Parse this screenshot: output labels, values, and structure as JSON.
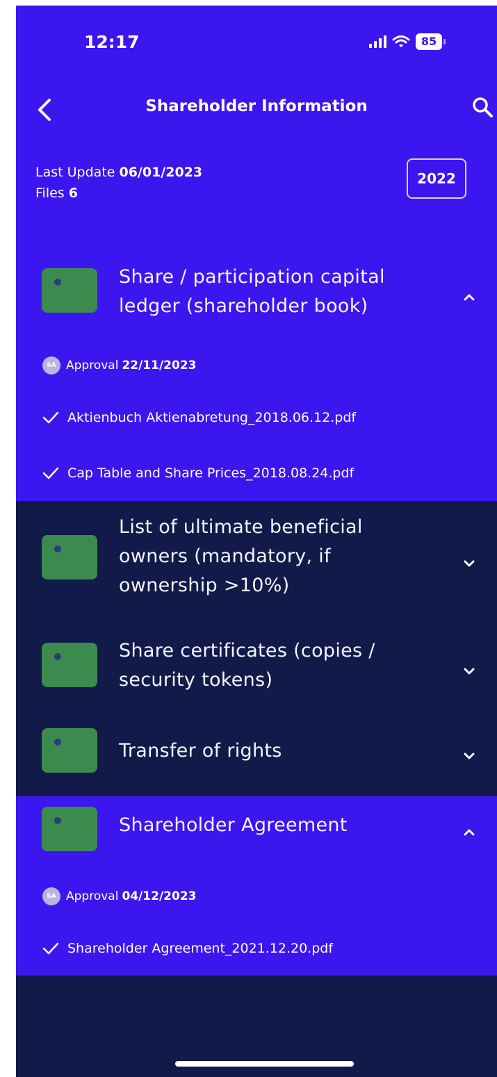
{
  "status": {
    "time": "12:17",
    "battery": "85"
  },
  "header": {
    "title": "Shareholder Information"
  },
  "meta": {
    "last_update_label": "Last Update",
    "last_update_value": "06/01/2023",
    "files_label": "Files",
    "files_value": "6",
    "year": "2022"
  },
  "sections": [
    {
      "title_lines": [
        "Share / participation capital",
        "ledger (shareholder book)"
      ],
      "expanded": true,
      "approval": {
        "avatar": "SA",
        "label": "Approval",
        "date": "22/11/2023"
      },
      "files": [
        "Aktienbuch Aktienabretung_2018.06.12.pdf",
        "Cap Table and Share Prices_2018.08.24.pdf"
      ]
    },
    {
      "title_lines": [
        "List of ultimate beneficial",
        "owners (mandatory, if",
        "ownership >10%)"
      ],
      "expanded": false
    },
    {
      "title_lines": [
        "Share certificates (copies /",
        "security tokens)"
      ],
      "expanded": false
    },
    {
      "title_lines": [
        "Transfer of rights"
      ],
      "expanded": false
    },
    {
      "title_lines": [
        "Shareholder Agreement"
      ],
      "expanded": true,
      "approval": {
        "avatar": "SA",
        "label": "Approval",
        "date": "04/12/2023"
      },
      "files": [
        "Shareholder Agreement_2021.12.20.pdf"
      ]
    }
  ],
  "colors": {
    "accent_blue": "#3b16ee",
    "dark_navy": "#121a4a",
    "folder_green": "#3c8a4e"
  }
}
